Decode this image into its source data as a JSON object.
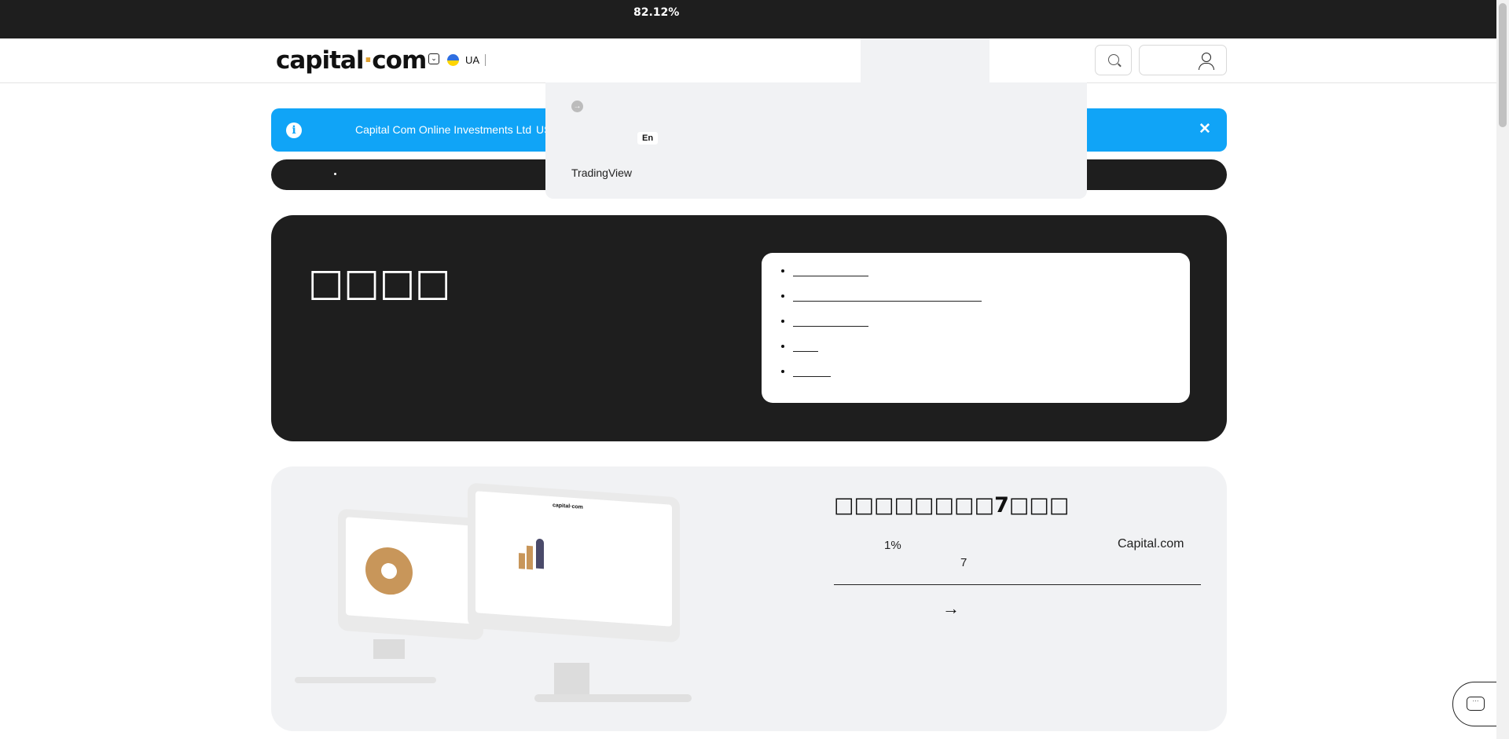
{
  "topbar": {
    "progress_text": "82.12%"
  },
  "header": {
    "logo_main": "capital",
    "logo_dot": "·",
    "logo_end": "com",
    "country_code": "UA",
    "search_icon": "search-icon",
    "user_icon": "user-icon"
  },
  "info_banner": {
    "text": "Capital Com Online Investments Ltd",
    "text2": "US",
    "close_label": "✕",
    "icon": "info-icon"
  },
  "dropdown": {
    "language_label": "En",
    "tradingview_label": "TradingView",
    "arrow_icon": "arrow-right-icon"
  },
  "hero": {
    "title": "□□□□",
    "toc_items": [
      "",
      "",
      "",
      "",
      ""
    ]
  },
  "promo": {
    "title": "□□□□□□□□7□□□",
    "percent": "1%",
    "brand": "Capital.com",
    "number": "7",
    "arrow": "→",
    "screen_brand": "capital·com"
  },
  "chat": {
    "icon": "chat-icon"
  },
  "colors": {
    "topbar_bg": "#1e1e1e",
    "info_blue": "#10a4f7",
    "hero_bg": "#1e1e1e",
    "promo_bg": "#f1f2f4",
    "accent": "#e0a030"
  }
}
